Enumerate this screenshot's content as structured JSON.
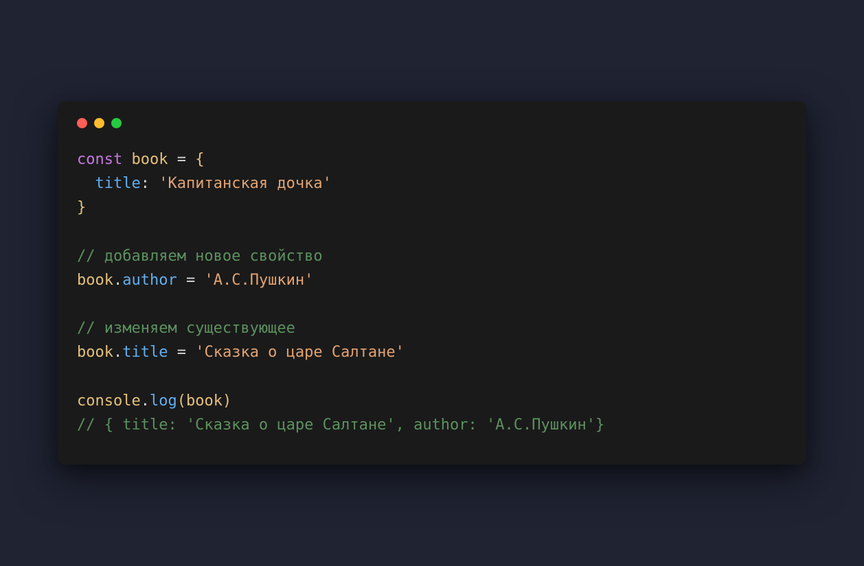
{
  "traffic_lights": {
    "red": "#ff5f56",
    "yellow": "#ffbd2e",
    "green": "#27c93f"
  },
  "code": {
    "line1": {
      "kw_const": "const",
      "space1": " ",
      "ident": "book",
      "space2": " ",
      "eq": "=",
      "space3": " ",
      "brace": "{"
    },
    "line2": {
      "indent": "  ",
      "prop": "title",
      "colon": ":",
      "space": " ",
      "string": "'Капитанская дочка'"
    },
    "line3": {
      "brace": "}"
    },
    "line5": {
      "comment": "// добавляем новое свойство"
    },
    "line6": {
      "obj": "book",
      "dot": ".",
      "prop": "author",
      "space1": " ",
      "eq": "=",
      "space2": " ",
      "string": "'А.С.Пушкин'"
    },
    "line8": {
      "comment": "// изменяем существующее"
    },
    "line9": {
      "obj": "book",
      "dot": ".",
      "prop": "title",
      "space1": " ",
      "eq": "=",
      "space2": " ",
      "string": "'Сказка о царе Салтане'"
    },
    "line11": {
      "obj": "console",
      "dot": ".",
      "method": "log",
      "paren_open": "(",
      "arg": "book",
      "paren_close": ")"
    },
    "line12": {
      "comment": "// { title: 'Сказка о царе Салтане', author: 'А.С.Пушкин'}"
    }
  }
}
